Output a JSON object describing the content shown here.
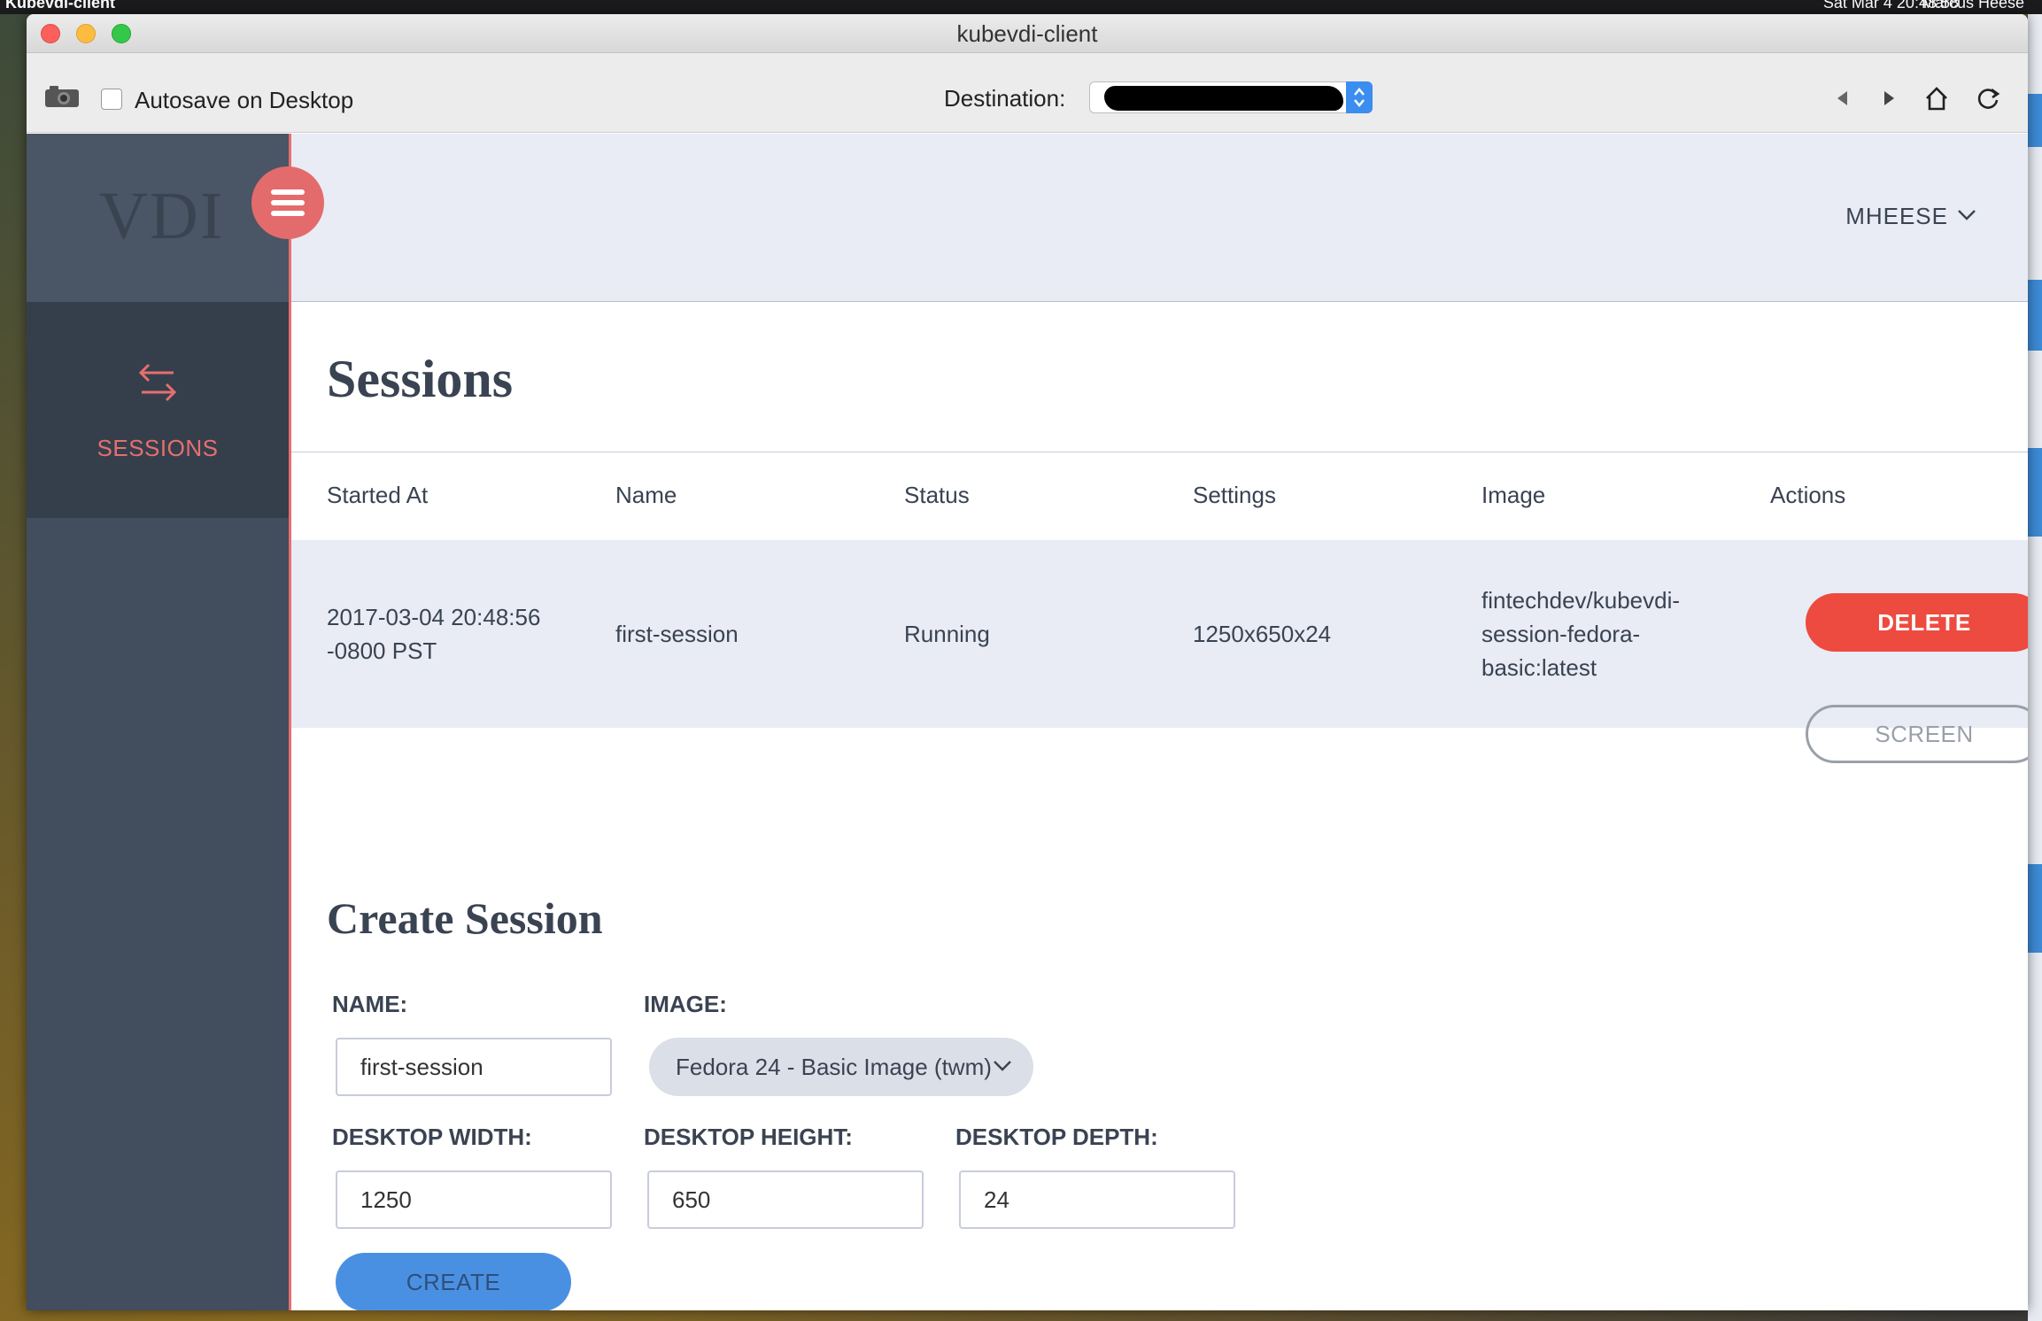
{
  "menubar": {
    "app_name": "Kubevdi-client",
    "clock": "Sat Mar 4 20:48:58",
    "user": "Marcus Heese"
  },
  "window": {
    "title": "kubevdi-client"
  },
  "toolbar": {
    "autosave_label": "Autosave on Desktop",
    "destination_label": "Destination:"
  },
  "sidebar": {
    "logo": "VDI",
    "nav": [
      {
        "label": "SESSIONS",
        "icon": "swap-arrows-icon"
      }
    ]
  },
  "header": {
    "user_menu": "MHEESE"
  },
  "sessions": {
    "title": "Sessions",
    "columns": [
      "Started At",
      "Name",
      "Status",
      "Settings",
      "Image",
      "Actions"
    ],
    "rows": [
      {
        "started_at_1": "2017-03-04 20:48:56",
        "started_at_2": "-0800 PST",
        "name": "first-session",
        "status": "Running",
        "settings": "1250x650x24",
        "image_1": "fintechdev/kubevdi-",
        "image_2": "session-fedora-",
        "image_3": "basic:latest",
        "delete_label": "DELETE",
        "screen_label": "SCREEN"
      }
    ]
  },
  "create_session": {
    "title": "Create Session",
    "name_label": "NAME:",
    "name_value": "first-session",
    "image_label": "IMAGE:",
    "image_value": "Fedora 24 - Basic Image (twm)",
    "width_label": "DESKTOP WIDTH:",
    "width_value": "1250",
    "height_label": "DESKTOP HEIGHT:",
    "height_value": "650",
    "depth_label": "DESKTOP DEPTH:",
    "depth_value": "24",
    "create_label": "CREATE"
  },
  "colors": {
    "accent_red": "#e66f6f",
    "delete_red": "#ed4b40",
    "create_blue": "#4a90e2",
    "sidebar_dark": "#424d5d",
    "header_bg": "#e9ecf4"
  }
}
